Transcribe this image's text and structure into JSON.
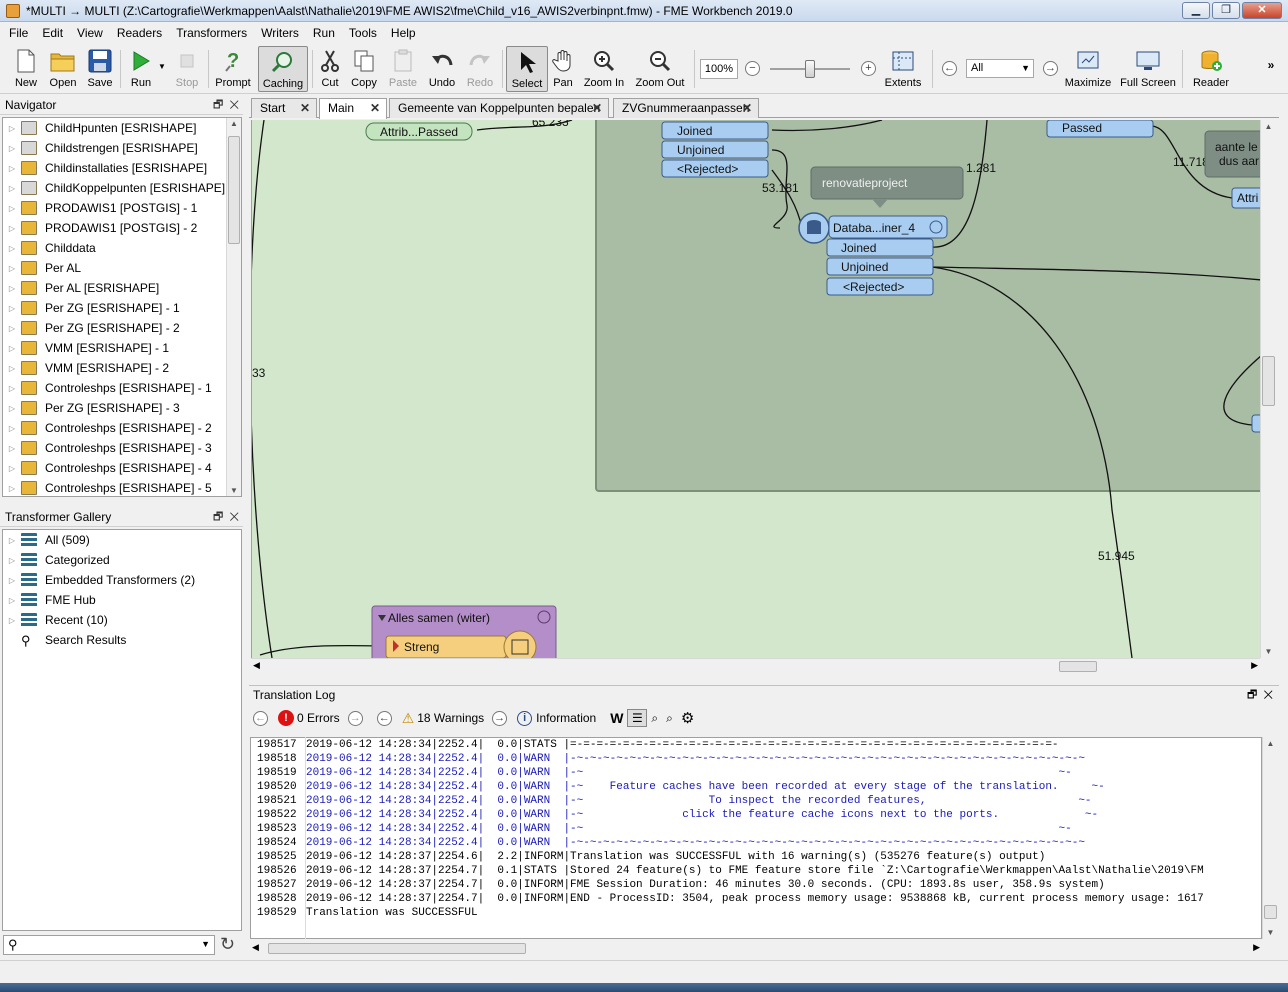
{
  "window": {
    "title": "*MULTI → MULTI (Z:\\Cartografie\\Werkmappen\\Aalst\\Nathalie\\2019\\FME AWIS2\\fme\\Child_v16_AWIS2verbinpnt.fmw) - FME Workbench 2019.0"
  },
  "menu": [
    "File",
    "Edit",
    "View",
    "Readers",
    "Transformers",
    "Writers",
    "Run",
    "Tools",
    "Help"
  ],
  "toolbar": {
    "new": "New",
    "open": "Open",
    "save": "Save",
    "run": "Run",
    "stop": "Stop",
    "prompt": "Prompt",
    "caching": "Caching",
    "cut": "Cut",
    "copy": "Copy",
    "paste": "Paste",
    "undo": "Undo",
    "redo": "Redo",
    "select": "Select",
    "pan": "Pan",
    "zoom_in": "Zoom In",
    "zoom_out": "Zoom Out",
    "zoom_value": "100%",
    "extents": "Extents",
    "filter_value": "All",
    "maximize": "Maximize",
    "full_screen": "Full Screen",
    "reader": "Reader"
  },
  "navigator": {
    "title": "Navigator",
    "items": [
      "ChildHpunten [ESRISHAPE]",
      "Childstrengen [ESRISHAPE]",
      "Childinstallaties [ESRISHAPE]",
      "ChildKoppelpunten [ESRISHAPE]",
      "PRODAWIS1 [POSTGIS] - 1",
      "PRODAWIS1 [POSTGIS] - 2",
      "Childdata",
      "Per AL",
      "Per AL [ESRISHAPE]",
      "Per ZG [ESRISHAPE] - 1",
      "Per ZG [ESRISHAPE] - 2",
      "VMM [ESRISHAPE] - 1",
      "VMM [ESRISHAPE] - 2",
      "Controleshps [ESRISHAPE] - 1",
      "Per ZG [ESRISHAPE] - 3",
      "Controleshps [ESRISHAPE] - 2",
      "Controleshps [ESRISHAPE] - 3",
      "Controleshps [ESRISHAPE] - 4",
      "Controleshps [ESRISHAPE] - 5"
    ]
  },
  "gallery": {
    "title": "Transformer Gallery",
    "items": [
      "All (509)",
      "Categorized",
      "Embedded Transformers (2)",
      "FME Hub",
      "Recent (10)",
      "Search Results"
    ]
  },
  "tabs": [
    "Start",
    "Main",
    "Gemeente van Koppelpunten bepalen",
    "ZVGnummeraanpassen"
  ],
  "canvas": {
    "attrib_passed": "Attrib...Passed",
    "value_65233": "65.233",
    "joined": "Joined",
    "unjoined": "Unjoined",
    "rejected": "<Rejected>",
    "value_53181": "53.181",
    "annotation": "renovatieproject",
    "value_1281": "1.281",
    "passed": "Passed",
    "value_11718": "11.718",
    "note_text_1": "aante le",
    "note_text_2": "dus aar",
    "attri": "Attri",
    "database_joiner": "Databa...iner_4",
    "value_51945": "51.945",
    "value_33": "33",
    "bookmark": "Alles samen (witer)",
    "streng": "Streng"
  },
  "log": {
    "title": "Translation Log",
    "errors": "0 Errors",
    "warnings": "18 Warnings",
    "information": "Information",
    "lines": [
      {
        "n": "198517",
        "t": "2019-06-12 14:28:34|2252.4|  0.0|STATS |=-=-=-=-=-=-=-=-=-=-=-=-=-=-=-=-=-=-=-=-=-=-=-=-=-=-=-=-=-=-=-=-=-=-=-=-=-",
        "c": "#000000"
      },
      {
        "n": "198518",
        "t": "2019-06-12 14:28:34|2252.4|  0.0|WARN  |-~-~-~-~-~-~-~-~-~-~-~-~-~-~-~-~-~-~-~-~-~-~-~-~-~-~-~-~-~-~-~-~-~-~-~-~-~-~-~",
        "c": "#1a1ab8"
      },
      {
        "n": "198519",
        "t": "2019-06-12 14:28:34|2252.4|  0.0|WARN  |-~                                                                        ~-",
        "c": "#1a1ab8"
      },
      {
        "n": "198520",
        "t": "2019-06-12 14:28:34|2252.4|  0.0|WARN  |-~    Feature caches have been recorded at every stage of the translation.     ~-",
        "c": "#1a1ab8"
      },
      {
        "n": "198521",
        "t": "2019-06-12 14:28:34|2252.4|  0.0|WARN  |-~                   To inspect the recorded features,                       ~-",
        "c": "#1a1ab8"
      },
      {
        "n": "198522",
        "t": "2019-06-12 14:28:34|2252.4|  0.0|WARN  |-~               click the feature cache icons next to the ports.             ~-",
        "c": "#1a1ab8"
      },
      {
        "n": "198523",
        "t": "2019-06-12 14:28:34|2252.4|  0.0|WARN  |-~                                                                        ~-",
        "c": "#1a1ab8"
      },
      {
        "n": "198524",
        "t": "2019-06-12 14:28:34|2252.4|  0.0|WARN  |-~-~-~-~-~-~-~-~-~-~-~-~-~-~-~-~-~-~-~-~-~-~-~-~-~-~-~-~-~-~-~-~-~-~-~-~-~-~-~",
        "c": "#1a1ab8"
      },
      {
        "n": "198525",
        "t": "2019-06-12 14:28:37|2254.6|  2.2|INFORM|Translation was SUCCESSFUL with 16 warning(s) (535276 feature(s) output)",
        "c": "#000000"
      },
      {
        "n": "198526",
        "t": "2019-06-12 14:28:37|2254.7|  0.1|STATS |Stored 24 feature(s) to FME feature store file `Z:\\Cartografie\\Werkmappen\\Aalst\\Nathalie\\2019\\FM",
        "c": "#000000"
      },
      {
        "n": "198527",
        "t": "2019-06-12 14:28:37|2254.7|  0.0|INFORM|FME Session Duration: 46 minutes 30.0 seconds. (CPU: 1893.8s user, 358.9s system)",
        "c": "#000000"
      },
      {
        "n": "198528",
        "t": "2019-06-12 14:28:37|2254.7|  0.0|INFORM|END - ProcessID: 3504, peak process memory usage: 9538868 kB, current process memory usage: 1617",
        "c": "#000000"
      },
      {
        "n": "198529",
        "t": "Translation was SUCCESSFUL",
        "c": "#000000"
      }
    ]
  }
}
